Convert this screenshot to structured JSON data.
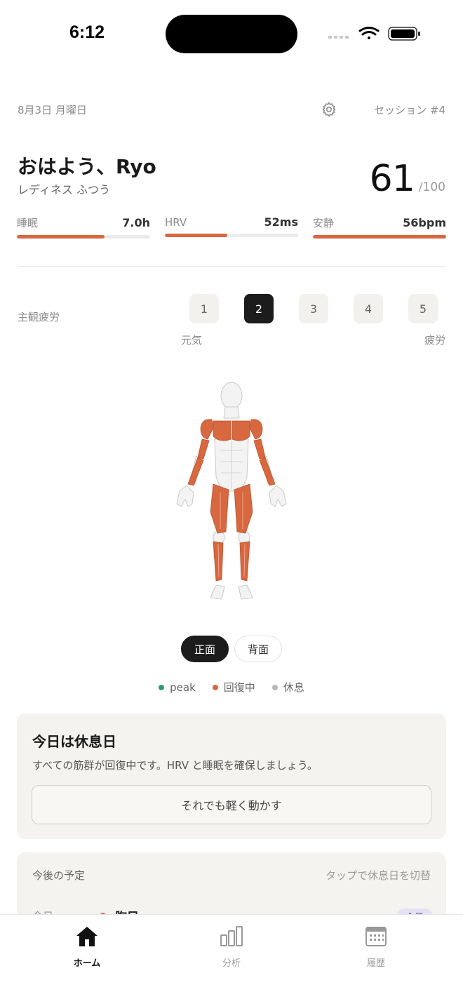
{
  "status_bar": {
    "time": "6:12"
  },
  "header": {
    "date": "8月3日 月曜日",
    "session": "セッション #4"
  },
  "greeting": {
    "title": "おはよう、Ryo",
    "readiness": "レディネス ふつう",
    "score": "61",
    "score_max": "/100"
  },
  "metrics": [
    {
      "label": "睡眠",
      "value": "7.0h",
      "progress": 0.66
    },
    {
      "label": "HRV",
      "value": "52ms",
      "progress": 0.47
    },
    {
      "label": "安静",
      "value": "56bpm",
      "progress": 1.0
    }
  ],
  "fatigue": {
    "label": "主観疲労",
    "options": [
      "1",
      "2",
      "3",
      "4",
      "5"
    ],
    "selected": "2",
    "low_label": "元気",
    "high_label": "疲労"
  },
  "body_view": {
    "front_label": "正面",
    "back_label": "背面",
    "active": "front"
  },
  "legend": [
    {
      "label": "peak",
      "color": "#2e9b6e"
    },
    {
      "label": "回復中",
      "color": "#d8683f"
    },
    {
      "label": "休息",
      "color": "#b8b8b8"
    }
  ],
  "rest_card": {
    "title": "今日は休息日",
    "description": "すべての筋群が回復中です。HRV と睡眠を確保しましょう。",
    "button": "それでも軽く動かす"
  },
  "schedule": {
    "title": "今後の予定",
    "hint": "タップで休息日を切替",
    "first_row": {
      "day": "今日",
      "part": "胸目",
      "badge": "今日"
    }
  },
  "tabs": [
    {
      "label": "ホーム",
      "icon": "home-icon",
      "active": true
    },
    {
      "label": "分析",
      "icon": "bar-chart-icon",
      "active": false
    },
    {
      "label": "履歴",
      "icon": "calendar-icon",
      "active": false
    }
  ],
  "colors": {
    "accent": "#d8683f",
    "peak": "#2e9b6e",
    "rest": "#b8b8b8",
    "card_bg": "#f4f3ef"
  }
}
